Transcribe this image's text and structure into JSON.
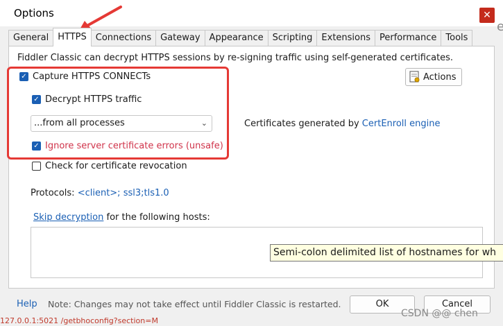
{
  "window": {
    "title": "Options",
    "close_glyph": "✕"
  },
  "background_fragment": "e",
  "tabs": [
    "General",
    "HTTPS",
    "Connections",
    "Gateway",
    "Appearance",
    "Scripting",
    "Extensions",
    "Performance",
    "Tools"
  ],
  "active_tab": "HTTPS",
  "https": {
    "intro": "Fiddler Classic can decrypt HTTPS sessions by re-signing traffic using self-generated certificates.",
    "capture_label": "Capture HTTPS CONNECTs",
    "capture_checked": true,
    "decrypt_label": "Decrypt HTTPS traffic",
    "decrypt_checked": true,
    "process_filter": "...from all processes",
    "ignore_errors_label": "Ignore server certificate errors (unsafe)",
    "ignore_errors_checked": true,
    "revocation_label": "Check for certificate revocation",
    "revocation_checked": false,
    "actions_label": "Actions",
    "cert_gen_prefix": "Certificates generated by ",
    "cert_gen_link": "CertEnroll engine",
    "protocols_label": "Protocols: ",
    "protocols_value": "<client>; ssl3;tls1.0",
    "skip_link": "Skip decryption",
    "skip_suffix": " for the following hosts:",
    "hosts_tooltip": "Semi-colon delimited list of hostnames for wh"
  },
  "footer": {
    "help_label": "Help",
    "note": "Note: Changes may not take effect until Fiddler Classic is restarted.",
    "ok_label": "OK",
    "cancel_label": "Cancel"
  },
  "background_status": "127.0.0.1:5021    /getbhoconfig?section=M",
  "watermark": "CSDN @@ chen",
  "colors": {
    "accent": "#1a5fb4",
    "annotation_red": "#e53935",
    "close_red": "#c42b1c"
  }
}
